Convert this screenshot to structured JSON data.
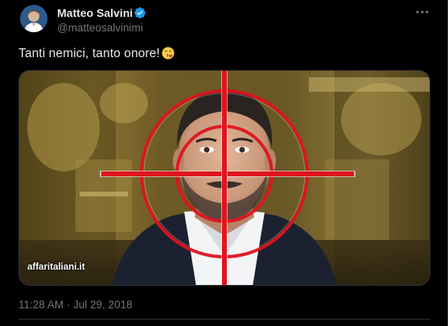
{
  "author": {
    "display_name": "Matteo Salvini",
    "handle": "@matteosalvinimi",
    "verified": true,
    "avatar_icon": "user-avatar"
  },
  "tweet": {
    "text": "Tanti nemici, tanto onore!",
    "emoji": "face-blowing-a-kiss",
    "timestamp": "11:28 AM · Jul 29, 2018"
  },
  "media": {
    "watermark": "affaritaliani.it",
    "overlay_color": "#e0141e"
  },
  "icons": {
    "more": "more-options-icon",
    "verified": "verified-badge-icon"
  },
  "colors": {
    "background": "#000000",
    "primary_text": "#e7e9ea",
    "secondary_text": "#71767b",
    "verified_blue": "#1d9bf0",
    "border": "#2f3336"
  }
}
